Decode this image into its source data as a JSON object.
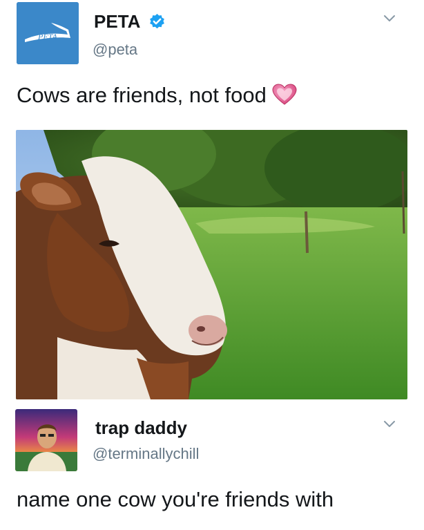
{
  "tweets": [
    {
      "name": "PETA",
      "handle": "@peta",
      "verified": true,
      "avatar_text": "PETA",
      "text": "Cows are friends, not food",
      "emoji": "heart-emoji"
    },
    {
      "name": "trap daddy",
      "handle": "@terminallychill",
      "verified": false,
      "text": "name one cow you're friends with"
    }
  ],
  "colors": {
    "text": "#14171a",
    "secondary": "#657786",
    "verified": "#1da1f2",
    "peta_avatar": "#3b88c9",
    "heart": "#e64d8a"
  }
}
